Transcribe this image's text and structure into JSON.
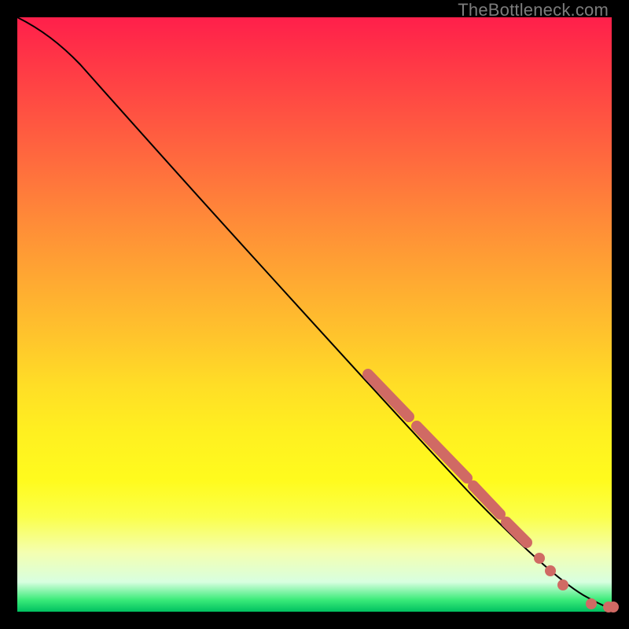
{
  "watermark": "TheBottleneck.com",
  "colors": {
    "curve": "#000000",
    "points": "#d06a64",
    "background_border": "#000000"
  },
  "chart_data": {
    "type": "line",
    "title": "",
    "xlabel": "",
    "ylabel": "",
    "xlim": [
      0,
      100
    ],
    "ylim": [
      0,
      100
    ],
    "series": [
      {
        "name": "curve",
        "x": [
          0,
          4,
          8,
          12,
          18,
          25,
          35,
          45,
          55,
          65,
          72,
          78,
          84,
          88,
          92,
          95,
          97,
          98.5,
          100
        ],
        "y": [
          100,
          98,
          95,
          91,
          85,
          77,
          66,
          55,
          44,
          33,
          25,
          18,
          12,
          8,
          5,
          2.5,
          1.2,
          0.4,
          0.2
        ]
      }
    ],
    "points": [
      {
        "x": 59.0,
        "y": 39.5
      },
      {
        "x": 60.5,
        "y": 38.0
      },
      {
        "x": 62.0,
        "y": 36.5
      },
      {
        "x": 63.5,
        "y": 35.0
      },
      {
        "x": 65.0,
        "y": 33.5
      },
      {
        "x": 67.5,
        "y": 30.5
      },
      {
        "x": 69.0,
        "y": 29.0
      },
      {
        "x": 70.5,
        "y": 27.5
      },
      {
        "x": 72.0,
        "y": 26.0
      },
      {
        "x": 73.5,
        "y": 24.5
      },
      {
        "x": 75.0,
        "y": 23.0
      },
      {
        "x": 77.0,
        "y": 20.5
      },
      {
        "x": 78.5,
        "y": 19.0
      },
      {
        "x": 80.0,
        "y": 17.0
      },
      {
        "x": 81.5,
        "y": 15.5
      },
      {
        "x": 83.0,
        "y": 13.5
      },
      {
        "x": 84.5,
        "y": 12.0
      },
      {
        "x": 86.0,
        "y": 10.0
      },
      {
        "x": 88.0,
        "y": 8.0
      },
      {
        "x": 89.5,
        "y": 6.0
      },
      {
        "x": 91.0,
        "y": 4.5
      },
      {
        "x": 93.0,
        "y": 3.0
      },
      {
        "x": 96.5,
        "y": 1.0
      },
      {
        "x": 99.5,
        "y": 0.5
      },
      {
        "x": 100.0,
        "y": 0.5
      }
    ]
  }
}
